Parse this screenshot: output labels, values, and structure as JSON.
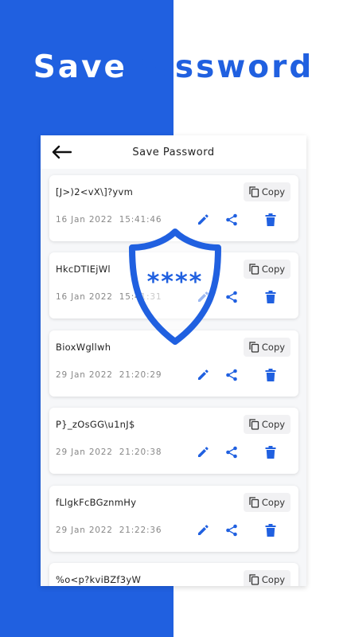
{
  "hero": {
    "title_part1": "Save",
    "title_part2": "Password"
  },
  "appbar": {
    "title": "Save Password"
  },
  "shield": {
    "stars": "****"
  },
  "copy_label": "Copy",
  "entries": [
    {
      "password": "[J>)2<vX\\]?yvm",
      "date": "16 Jan 2022",
      "time": "15:41:46"
    },
    {
      "password": "HkcDTIEjWl",
      "date": "16 Jan 2022",
      "time": "15:41:31"
    },
    {
      "password": "BioxWgllwh",
      "date": "29 Jan 2022",
      "time": "21:20:29"
    },
    {
      "password": "P}_zOsGG\\u1nJ$",
      "date": "29 Jan 2022",
      "time": "21:20:38"
    },
    {
      "password": "fLlgkFcBGznmHy",
      "date": "29 Jan 2022",
      "time": "21:22:36"
    },
    {
      "password": "%o<p?kviBZf3yW",
      "date": "",
      "time": ""
    }
  ],
  "colors": {
    "accent": "#2060e0",
    "background": "#ffffff",
    "card": "#ffffff"
  }
}
